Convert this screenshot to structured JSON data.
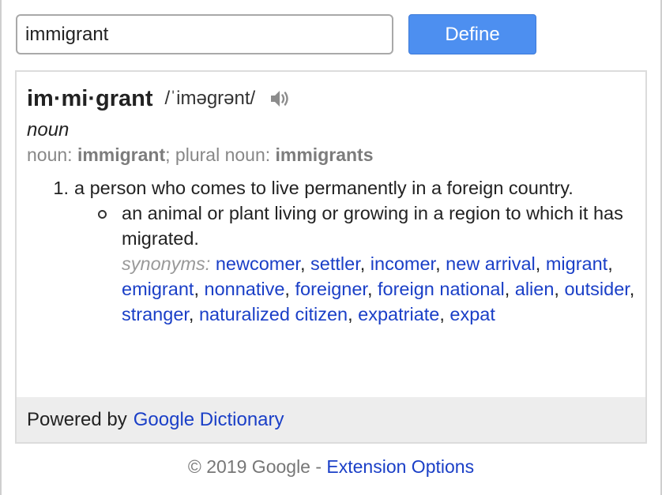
{
  "search": {
    "value": "immigrant",
    "button_label": "Define"
  },
  "entry": {
    "headword": "im·mi·grant",
    "phonetic": "/ˈiməɡrənt/",
    "audio_icon": "speaker-icon",
    "part_of_speech": "noun",
    "forms": {
      "label1": "noun: ",
      "word1": "immigrant",
      "sep": "; ",
      "label2": "plural noun: ",
      "word2": "immigrants"
    },
    "definitions": [
      {
        "number": "1.",
        "text": "a person who comes to live permanently in a foreign country.",
        "subsense": {
          "text": "an animal or plant living or growing in a region to which it has migrated.",
          "synonyms_label": "synonyms:",
          "synonyms": [
            "newcomer",
            "settler",
            "incomer",
            "new arrival",
            "migrant",
            "emigrant",
            "nonnative",
            "foreigner",
            "foreign national",
            "alien",
            "outsider",
            "stranger",
            "naturalized citizen",
            "expatriate",
            "expat"
          ]
        }
      }
    ]
  },
  "card_footer": {
    "prefix": "Powered by",
    "link": "Google Dictionary"
  },
  "page_footer": {
    "copyright": "© 2019 Google - ",
    "link": "Extension Options"
  },
  "colors": {
    "button": "#4d8ff0",
    "link": "#1a3fc7",
    "muted": "#878787"
  }
}
